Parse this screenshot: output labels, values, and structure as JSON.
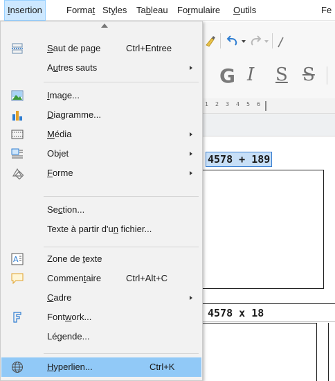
{
  "menubar": [
    {
      "before": "",
      "key": "I",
      "after": "nsertion",
      "active": true
    },
    {
      "before": "Forma",
      "key": "t",
      "after": "",
      "active": false
    },
    {
      "before": "St",
      "key": "y",
      "after": "les",
      "active": false
    },
    {
      "before": "Ta",
      "key": "b",
      "after": "leau",
      "active": false
    },
    {
      "before": "Fo",
      "key": "r",
      "after": "mulaire",
      "active": false
    },
    {
      "before": "",
      "key": "O",
      "after": "utils",
      "active": false
    },
    {
      "before": "Fe",
      "key": "",
      "after": "",
      "active": false
    }
  ],
  "toolbar": {
    "bold_glyph": "G",
    "italic_glyph": "I",
    "underline_glyph": "S",
    "strike_glyph": "S",
    "ruler_ticks": [
      "1",
      "2",
      "3",
      "4",
      "5",
      "6"
    ]
  },
  "document": {
    "cell1_title": "4578 + 189",
    "cell2_title": "4578 x 18"
  },
  "menu": {
    "items": [
      {
        "icon": "page-break-icon",
        "before": "",
        "key": "S",
        "after": "aut de page",
        "shortcut": "Ctrl+Entree",
        "submenu": false
      },
      {
        "icon": "",
        "before": "A",
        "key": "u",
        "after": "tres sauts",
        "shortcut": "",
        "submenu": true
      },
      {
        "icon": "image-icon",
        "before": "",
        "key": "I",
        "after": "mage...",
        "shortcut": "",
        "submenu": false
      },
      {
        "icon": "chart-icon",
        "before": "",
        "key": "D",
        "after": "iagramme...",
        "shortcut": "",
        "submenu": false
      },
      {
        "icon": "media-icon",
        "before": "",
        "key": "M",
        "after": "édia",
        "shortcut": "",
        "submenu": true
      },
      {
        "icon": "object-icon",
        "before": "Objet",
        "key": "",
        "after": "",
        "shortcut": "",
        "submenu": true
      },
      {
        "icon": "shape-icon",
        "before": "",
        "key": "F",
        "after": "orme",
        "shortcut": "",
        "submenu": true
      },
      {
        "icon": "",
        "before": "Se",
        "key": "c",
        "after": "tion...",
        "shortcut": "",
        "submenu": false
      },
      {
        "icon": "",
        "before": "Texte à partir d'u",
        "key": "n",
        "after": " fichier...",
        "shortcut": "",
        "submenu": false
      },
      {
        "icon": "text-box-icon",
        "before": "Zone de ",
        "key": "t",
        "after": "exte",
        "shortcut": "",
        "submenu": false
      },
      {
        "icon": "comment-icon",
        "before": "Commen",
        "key": "t",
        "after": "aire",
        "shortcut": "Ctrl+Alt+C",
        "submenu": false
      },
      {
        "icon": "",
        "before": "",
        "key": "C",
        "after": "adre",
        "shortcut": "",
        "submenu": true
      },
      {
        "icon": "fontwork-icon",
        "before": "Font",
        "key": "w",
        "after": "ork...",
        "shortcut": "",
        "submenu": false
      },
      {
        "icon": "",
        "before": "Lé",
        "key": "g",
        "after": "ende...",
        "shortcut": "",
        "submenu": false
      },
      {
        "icon": "hyperlink-icon",
        "before": "",
        "key": "H",
        "after": "yperlien...",
        "shortcut": "Ctrl+K",
        "submenu": false,
        "highlighted": true
      }
    ]
  },
  "colors": {
    "menu_bg": "#f2f2f2",
    "highlight": "#91c9f7",
    "menubar_active": "#cde8ff",
    "selection": "#c7dff7"
  }
}
